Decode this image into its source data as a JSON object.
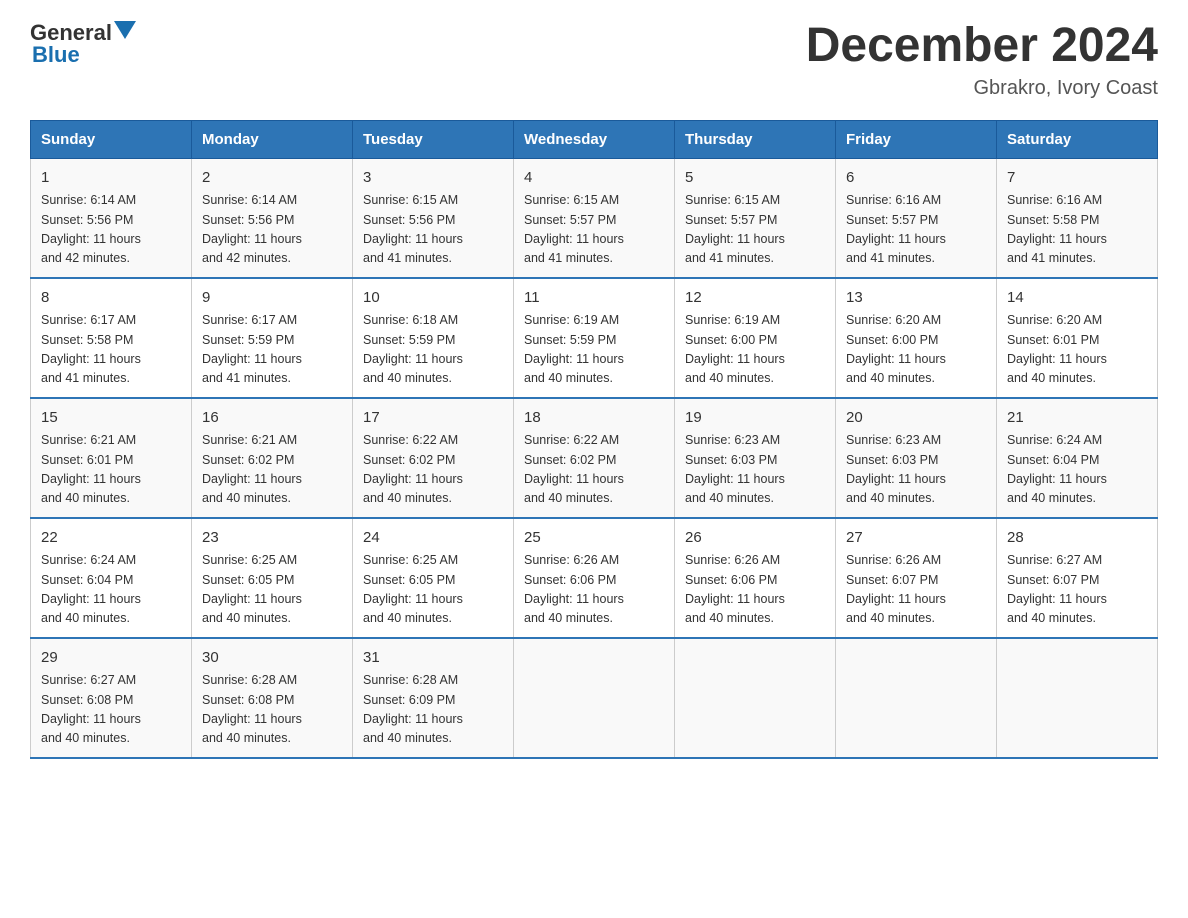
{
  "header": {
    "logo": {
      "text_general": "General",
      "text_blue": "Blue",
      "aria": "GeneralBlue logo"
    },
    "title": "December 2024",
    "subtitle": "Gbrakro, Ivory Coast"
  },
  "calendar": {
    "days_of_week": [
      "Sunday",
      "Monday",
      "Tuesday",
      "Wednesday",
      "Thursday",
      "Friday",
      "Saturday"
    ],
    "weeks": [
      [
        {
          "day": "1",
          "sunrise": "6:14 AM",
          "sunset": "5:56 PM",
          "daylight": "11 hours and 42 minutes."
        },
        {
          "day": "2",
          "sunrise": "6:14 AM",
          "sunset": "5:56 PM",
          "daylight": "11 hours and 42 minutes."
        },
        {
          "day": "3",
          "sunrise": "6:15 AM",
          "sunset": "5:56 PM",
          "daylight": "11 hours and 41 minutes."
        },
        {
          "day": "4",
          "sunrise": "6:15 AM",
          "sunset": "5:57 PM",
          "daylight": "11 hours and 41 minutes."
        },
        {
          "day": "5",
          "sunrise": "6:15 AM",
          "sunset": "5:57 PM",
          "daylight": "11 hours and 41 minutes."
        },
        {
          "day": "6",
          "sunrise": "6:16 AM",
          "sunset": "5:57 PM",
          "daylight": "11 hours and 41 minutes."
        },
        {
          "day": "7",
          "sunrise": "6:16 AM",
          "sunset": "5:58 PM",
          "daylight": "11 hours and 41 minutes."
        }
      ],
      [
        {
          "day": "8",
          "sunrise": "6:17 AM",
          "sunset": "5:58 PM",
          "daylight": "11 hours and 41 minutes."
        },
        {
          "day": "9",
          "sunrise": "6:17 AM",
          "sunset": "5:59 PM",
          "daylight": "11 hours and 41 minutes."
        },
        {
          "day": "10",
          "sunrise": "6:18 AM",
          "sunset": "5:59 PM",
          "daylight": "11 hours and 40 minutes."
        },
        {
          "day": "11",
          "sunrise": "6:19 AM",
          "sunset": "5:59 PM",
          "daylight": "11 hours and 40 minutes."
        },
        {
          "day": "12",
          "sunrise": "6:19 AM",
          "sunset": "6:00 PM",
          "daylight": "11 hours and 40 minutes."
        },
        {
          "day": "13",
          "sunrise": "6:20 AM",
          "sunset": "6:00 PM",
          "daylight": "11 hours and 40 minutes."
        },
        {
          "day": "14",
          "sunrise": "6:20 AM",
          "sunset": "6:01 PM",
          "daylight": "11 hours and 40 minutes."
        }
      ],
      [
        {
          "day": "15",
          "sunrise": "6:21 AM",
          "sunset": "6:01 PM",
          "daylight": "11 hours and 40 minutes."
        },
        {
          "day": "16",
          "sunrise": "6:21 AM",
          "sunset": "6:02 PM",
          "daylight": "11 hours and 40 minutes."
        },
        {
          "day": "17",
          "sunrise": "6:22 AM",
          "sunset": "6:02 PM",
          "daylight": "11 hours and 40 minutes."
        },
        {
          "day": "18",
          "sunrise": "6:22 AM",
          "sunset": "6:02 PM",
          "daylight": "11 hours and 40 minutes."
        },
        {
          "day": "19",
          "sunrise": "6:23 AM",
          "sunset": "6:03 PM",
          "daylight": "11 hours and 40 minutes."
        },
        {
          "day": "20",
          "sunrise": "6:23 AM",
          "sunset": "6:03 PM",
          "daylight": "11 hours and 40 minutes."
        },
        {
          "day": "21",
          "sunrise": "6:24 AM",
          "sunset": "6:04 PM",
          "daylight": "11 hours and 40 minutes."
        }
      ],
      [
        {
          "day": "22",
          "sunrise": "6:24 AM",
          "sunset": "6:04 PM",
          "daylight": "11 hours and 40 minutes."
        },
        {
          "day": "23",
          "sunrise": "6:25 AM",
          "sunset": "6:05 PM",
          "daylight": "11 hours and 40 minutes."
        },
        {
          "day": "24",
          "sunrise": "6:25 AM",
          "sunset": "6:05 PM",
          "daylight": "11 hours and 40 minutes."
        },
        {
          "day": "25",
          "sunrise": "6:26 AM",
          "sunset": "6:06 PM",
          "daylight": "11 hours and 40 minutes."
        },
        {
          "day": "26",
          "sunrise": "6:26 AM",
          "sunset": "6:06 PM",
          "daylight": "11 hours and 40 minutes."
        },
        {
          "day": "27",
          "sunrise": "6:26 AM",
          "sunset": "6:07 PM",
          "daylight": "11 hours and 40 minutes."
        },
        {
          "day": "28",
          "sunrise": "6:27 AM",
          "sunset": "6:07 PM",
          "daylight": "11 hours and 40 minutes."
        }
      ],
      [
        {
          "day": "29",
          "sunrise": "6:27 AM",
          "sunset": "6:08 PM",
          "daylight": "11 hours and 40 minutes."
        },
        {
          "day": "30",
          "sunrise": "6:28 AM",
          "sunset": "6:08 PM",
          "daylight": "11 hours and 40 minutes."
        },
        {
          "day": "31",
          "sunrise": "6:28 AM",
          "sunset": "6:09 PM",
          "daylight": "11 hours and 40 minutes."
        },
        null,
        null,
        null,
        null
      ]
    ]
  }
}
